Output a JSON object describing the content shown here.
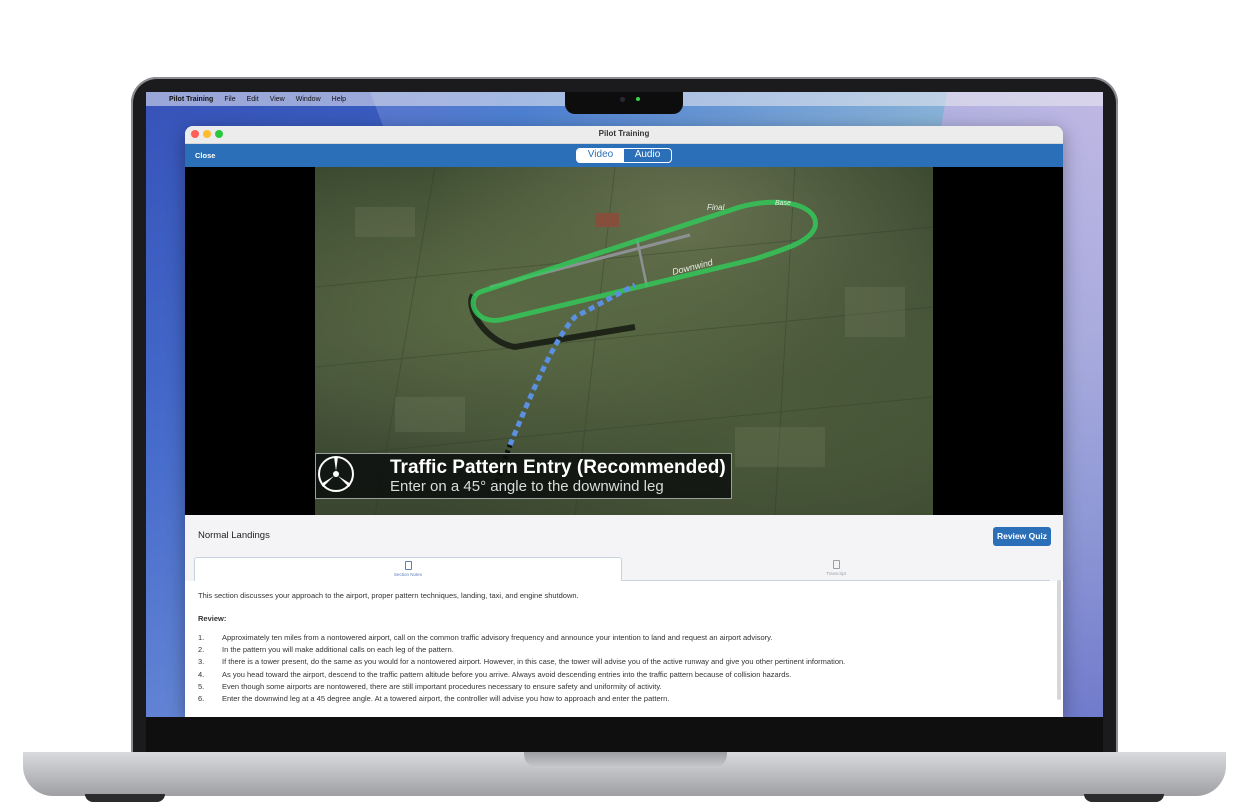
{
  "menubar": {
    "apple_icon": "",
    "app_name": "Pilot Training",
    "items": [
      "File",
      "Edit",
      "View",
      "Window",
      "Help"
    ]
  },
  "window": {
    "title": "Pilot Training",
    "close_label": "Close",
    "segments": {
      "video": "Video",
      "audio": "Audio",
      "selected": "Video"
    }
  },
  "video": {
    "caption_title": "Traffic Pattern Entry (Recommended)",
    "caption_subtitle": "Enter on a 45° angle to the downwind leg",
    "leg_labels": {
      "final": "Final",
      "base": "Base",
      "downwind": "Downwind"
    }
  },
  "lesson": {
    "title": "Normal Landings",
    "review_quiz_label": "Review Quiz",
    "tabs": [
      {
        "label": "Section Notes",
        "icon": "notes-icon",
        "active": true
      },
      {
        "label": "Transcript",
        "icon": "transcript-icon",
        "active": false
      }
    ]
  },
  "notes": {
    "intro": "This section discusses your approach to the airport, proper pattern techniques, landing, taxi, and engine shutdown.",
    "review_heading": "Review:",
    "items": [
      {
        "num": "1.",
        "text": "Approximately ten miles from a nontowered airport, call on the common traffic advisory frequency and announce your intention to land and request an airport advisory."
      },
      {
        "num": "2.",
        "text": "In the pattern you will make additional calls on each leg of the pattern."
      },
      {
        "num": "3.",
        "text": "If there is a tower present, do the same as you would for a nontowered airport. However, in this case, the tower will advise you of the active runway and give you other pertinent information."
      },
      {
        "num": "4.",
        "text": "As you head toward the airport, descend to the traffic pattern altitude before you arrive. Always avoid descending entries into the traffic pattern because of collision hazards."
      },
      {
        "num": "5.",
        "text": "Even though some airports are nontowered, there are still important procedures necessary to ensure safety and uniformity of activity."
      },
      {
        "num": "6.",
        "text": "Enter the downwind leg at a 45 degree angle. At a towered airport, the controller will advise you how to approach and enter the pattern."
      }
    ]
  },
  "colors": {
    "accent": "#2a6fb8",
    "pattern_green": "#34c759",
    "entry_blue": "#5b8fe0"
  }
}
